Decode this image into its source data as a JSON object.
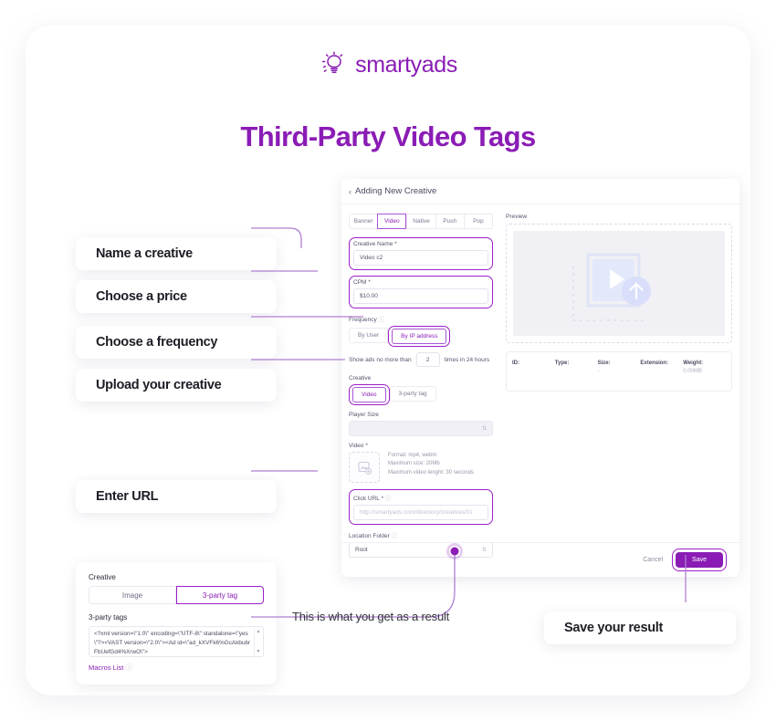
{
  "brand": {
    "logo_text": "smartyads",
    "accent": "#8a1cb5",
    "line_color": "#b07fd0"
  },
  "page_title": "Third-Party Video Tags",
  "app": {
    "header": "Adding New Creative",
    "back_chevron": "‹",
    "tabs": [
      {
        "label": "Banner",
        "active": false
      },
      {
        "label": "Video",
        "active": true
      },
      {
        "label": "Native",
        "active": false
      },
      {
        "label": "Push",
        "active": false
      },
      {
        "label": "Pop",
        "active": false
      }
    ],
    "creative_name": {
      "label": "Creative Name *",
      "value": "Video c2"
    },
    "cpm": {
      "label": "CPM *",
      "value": "$10.00"
    },
    "frequency": {
      "label": "Frequency",
      "options": [
        {
          "label": "By User",
          "selected": false
        },
        {
          "label": "By IP address",
          "selected": true
        }
      ],
      "note_prefix": "Show ads no more than",
      "count": "2",
      "note_suffix": "times in 24 hours"
    },
    "creative_type": {
      "label": "Creative",
      "options": [
        {
          "label": "Video",
          "selected": true
        },
        {
          "label": "3-party tag",
          "selected": false
        }
      ]
    },
    "player_size": {
      "label": "Player Size",
      "value": ""
    },
    "video": {
      "label": "Video *",
      "lines": [
        "Format: mp4, webm",
        "Maximum size: 20Mb",
        "Maximum video lenght: 30 seconds"
      ]
    },
    "click_url": {
      "label": "Click URL *",
      "placeholder": "http://smartyads.com/directory/creatives/01"
    },
    "location_folder": {
      "label": "Location Folder",
      "value": "Root"
    },
    "preview": {
      "label": "Preview",
      "meta": [
        {
          "key": "ID:",
          "value": ""
        },
        {
          "key": "Type:",
          "value": ""
        },
        {
          "key": "Size:",
          "value": "-"
        },
        {
          "key": "Extension:",
          "value": ""
        },
        {
          "key": "Weight:",
          "value": "0.00MB"
        }
      ]
    },
    "footer": {
      "cancel": "Cancel",
      "save": "Save"
    }
  },
  "callouts": {
    "name_creative": "Name a creative",
    "choose_price": "Choose a price",
    "choose_frequency": "Choose a frequency",
    "upload_creative": "Upload your creative",
    "enter_url": "Enter URL",
    "save_result": "Save your result",
    "result_note": "This is what you get as a result"
  },
  "result_card": {
    "creative_label": "Creative",
    "tabs": [
      {
        "label": "Image",
        "active": false
      },
      {
        "label": "3-party tag",
        "active": true
      }
    ],
    "tags_label": "3-party tags",
    "code": "<?xml version=\\\"1.0\\\" encoding=\\\"UTF-8\\\" standalone=\\\"yes\\\"?><VAST version=\\\"2.0\\\"><Ad id=\\\"ad_kXVFk6%GcAkbubrFbUefGd4%XrwO\\\">",
    "macros_link": "Macros List",
    "scroll_up": "▲",
    "scroll_down": "▼"
  }
}
